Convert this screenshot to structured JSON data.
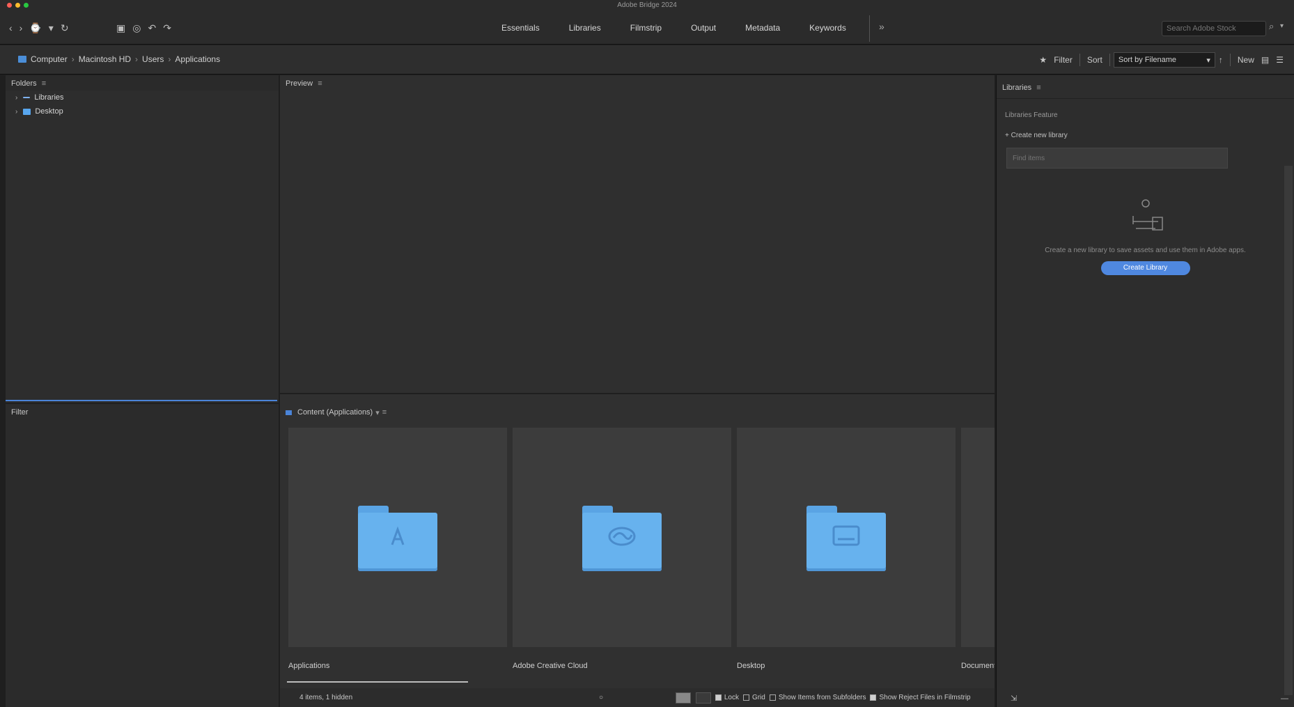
{
  "window": {
    "title": "Adobe Bridge 2024"
  },
  "toolbar": {
    "back": "‹",
    "forward": "›",
    "history": "⌚",
    "recent_menu": "▾",
    "boomerang": "↻",
    "get_photos": "▣",
    "refine": "◎",
    "rotate_left": "↶",
    "rotate_right": "↷",
    "workspaces": [
      "Essentials",
      "Libraries",
      "Filmstrip",
      "Output",
      "Metadata",
      "Keywords"
    ],
    "more_icon": "»",
    "search_placeholder": "Search Adobe Stock",
    "search_icon": "⌕",
    "search_dropdown": "▾"
  },
  "pathbar": {
    "crumbs": [
      "Computer",
      "Macintosh HD",
      "Users",
      "Applications"
    ],
    "separator": "›",
    "tools": {
      "rating": "★",
      "filter": "Filter",
      "sort_label": "Sort",
      "sort_value": "Sort by Filename",
      "sort_dd": "▾",
      "sort_dir": "↑",
      "new_folder": "New",
      "thumb": "▤",
      "list": "☰"
    }
  },
  "favorites": {
    "title": "Folders",
    "caret": "≡",
    "items": [
      {
        "chev": "›",
        "label": "Libraries"
      },
      {
        "chev": "›",
        "label": "Desktop"
      }
    ]
  },
  "filter_panel": {
    "title": "Filter"
  },
  "preview": {
    "title": "Preview",
    "caret": "≡"
  },
  "content": {
    "title": "Content (Applications)",
    "caret": "≡",
    "sort_icon": "▾",
    "items": [
      {
        "label": "Applications"
      },
      {
        "label": "Adobe Creative Cloud"
      },
      {
        "label": "Desktop"
      },
      {
        "label": "Documents"
      }
    ],
    "footer": {
      "status": "4 items, 1 hidden",
      "zoom_icon": "○",
      "opt1": "Lock",
      "opt2": "Grid",
      "opt3": "Show Items from Subfolders",
      "opt4": "Show Reject Files in Filmstrip"
    }
  },
  "metadata": {
    "title": "Libraries",
    "caret": "≡",
    "line": "Libraries Feature",
    "add": "Create new library",
    "input_placeholder": "Find items",
    "empty_msg": "Create a new library to save assets and use them in Adobe apps.",
    "button": "Create Library",
    "footer_left": "⇲",
    "footer_right": "—"
  }
}
